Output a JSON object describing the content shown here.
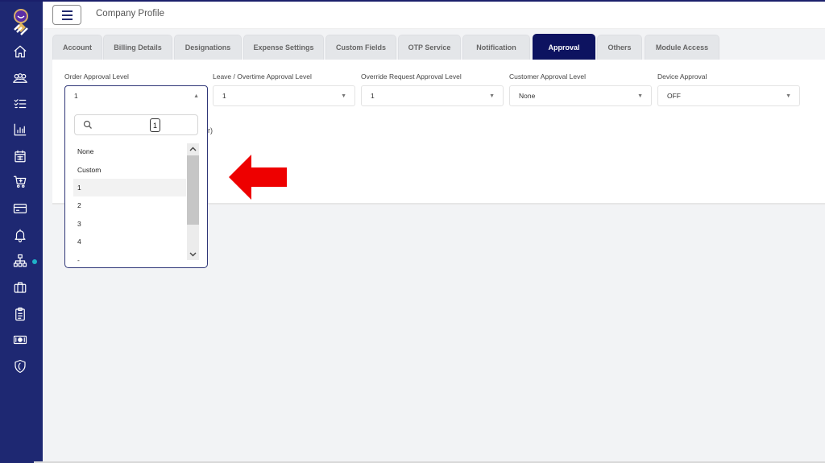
{
  "header": {
    "title": "Company Profile",
    "menu_icon": "hamburger-icon"
  },
  "sidebar": {
    "logo": "app-logo",
    "items": [
      {
        "icon": "home-icon"
      },
      {
        "icon": "users-icon"
      },
      {
        "icon": "checklist-icon"
      },
      {
        "icon": "bar-chart-icon"
      },
      {
        "icon": "calendar-icon"
      },
      {
        "icon": "cart-icon"
      },
      {
        "icon": "credit-card-icon"
      },
      {
        "icon": "bell-icon"
      },
      {
        "icon": "org-chart-icon",
        "active_dot": true,
        "dot_color": "#1fb2c9"
      },
      {
        "icon": "briefcase-icon"
      },
      {
        "icon": "clipboard-icon"
      },
      {
        "icon": "cash-icon"
      },
      {
        "icon": "shield-icon"
      }
    ]
  },
  "tabs": [
    {
      "label": "Account"
    },
    {
      "label": "Billing Details"
    },
    {
      "label": "Designations"
    },
    {
      "label": "Expense Settings"
    },
    {
      "label": "Custom Fields"
    },
    {
      "label": "OTP Service"
    },
    {
      "label": "Notification"
    },
    {
      "label": "Approval",
      "active": true
    },
    {
      "label": "Others"
    },
    {
      "label": "Module Access"
    }
  ],
  "fields": [
    {
      "label": "Order Approval Level",
      "value": "1",
      "open": true
    },
    {
      "label": "Leave / Overtime Approval Level",
      "value": "1"
    },
    {
      "label": "Override Request Approval Level",
      "value": "1"
    },
    {
      "label": "Customer Approval Level",
      "value": "None"
    },
    {
      "label": "Device Approval",
      "value": "OFF"
    }
  ],
  "partially_hidden_text": "r)",
  "dropdown": {
    "search_value": "",
    "typed_key": "1",
    "options": [
      "None",
      "Custom",
      "1",
      "2",
      "3",
      "4",
      "-"
    ],
    "highlighted": "1"
  },
  "annotation": {
    "type": "arrow-left",
    "color": "#ee0000"
  },
  "colors": {
    "sidebar": "#1e2872",
    "active_tab": "#0d1360",
    "accent_dot": "#1fb2c9"
  }
}
